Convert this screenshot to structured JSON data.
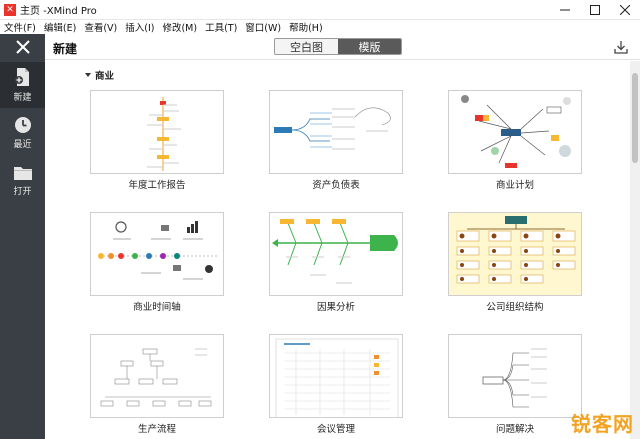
{
  "window": {
    "title": "主页 -XMind Pro",
    "controls": [
      "minimize",
      "maximize",
      "close"
    ]
  },
  "menu": [
    "文件(F)",
    "编辑(E)",
    "查看(V)",
    "插入(I)",
    "修改(M)",
    "工具(T)",
    "窗口(W)",
    "帮助(H)"
  ],
  "sidebar": {
    "items": [
      {
        "label": "新建",
        "icon": "new-file-icon"
      },
      {
        "label": "最近",
        "icon": "clock-icon"
      },
      {
        "label": "打开",
        "icon": "folder-icon"
      }
    ]
  },
  "header": {
    "title": "新建",
    "tabs": [
      {
        "label": "空白图",
        "active": false
      },
      {
        "label": "模版",
        "active": true
      }
    ]
  },
  "section": {
    "title": "商业"
  },
  "templates": [
    {
      "label": "年度工作报告"
    },
    {
      "label": "资产负债表"
    },
    {
      "label": "商业计划"
    },
    {
      "label": "商业时间轴"
    },
    {
      "label": "因果分析"
    },
    {
      "label": "公司组织结构"
    },
    {
      "label": "生产流程"
    },
    {
      "label": "会议管理"
    },
    {
      "label": "问题解决"
    }
  ],
  "watermark": "锐客网",
  "colors": {
    "sidebar_bg": "#3a3f45",
    "accent_red": "#e8342b",
    "green": "#3cb44b"
  }
}
